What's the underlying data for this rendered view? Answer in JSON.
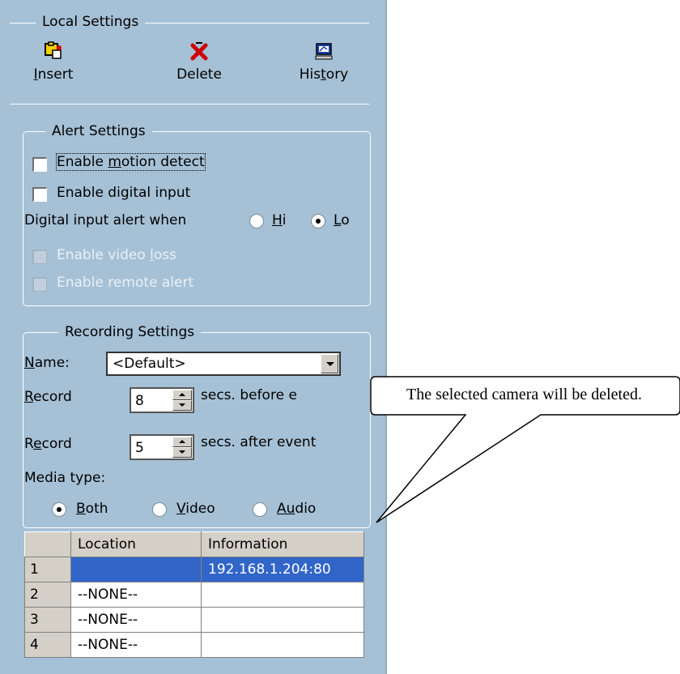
{
  "local_settings": {
    "title": "Local Settings",
    "tools": [
      {
        "icon": "insert-camera-icon",
        "label_pre": "",
        "label_u": "I",
        "label_post": "nsert"
      },
      {
        "icon": "delete-x-icon",
        "label_pre": "Delete",
        "label_u": "",
        "label_post": ""
      },
      {
        "icon": "history-monitor-icon",
        "label_pre": "His",
        "label_u": "t",
        "label_post": "ory"
      }
    ]
  },
  "alert_settings": {
    "title": "Alert Settings",
    "motion": {
      "pre": "Enable ",
      "u": "m",
      "post": "otion detect",
      "checked": false
    },
    "digital": {
      "pre": "Enable digital input",
      "checked": false
    },
    "alert_when": "Digital input alert when",
    "hi": {
      "u": "H",
      "post": "i",
      "selected": false
    },
    "lo": {
      "u": "L",
      "post": "o",
      "selected": true
    },
    "video_loss": {
      "pre": "Enable video ",
      "u": "l",
      "post": "oss",
      "enabled": false
    },
    "remote_alert": {
      "label": "Enable remote alert",
      "enabled": false
    }
  },
  "recording_settings": {
    "title": "Recording Settings",
    "name_label": {
      "u": "N",
      "post": "ame:"
    },
    "name_value": "<Default>",
    "before": {
      "u": "R",
      "post": "ecord",
      "value": "8",
      "suffix": "secs. before e"
    },
    "after": {
      "pre": "R",
      "u": "e",
      "post": "cord",
      "value": "5",
      "suffix": "secs. after event"
    },
    "media_type_label": "Media type:",
    "media": [
      {
        "u": "B",
        "post": "oth",
        "selected": true
      },
      {
        "u": "V",
        "post": "ideo",
        "selected": false
      },
      {
        "u": "Au",
        "post": "dio",
        "selected": false
      }
    ]
  },
  "table": {
    "headers": [
      "",
      "Location",
      "Information"
    ],
    "rows": [
      {
        "num": "1",
        "location": "",
        "information": "192.168.1.204:80"
      },
      {
        "num": "2",
        "location": "--NONE--",
        "information": ""
      },
      {
        "num": "3",
        "location": "--NONE--",
        "information": ""
      },
      {
        "num": "4",
        "location": "--NONE--",
        "information": ""
      }
    ]
  },
  "tooltip": {
    "text": "The selected camera will be deleted."
  },
  "colors": {
    "panel": "#a6c1d6",
    "selection": "#3165c8",
    "delete_icon": "#cc0000"
  }
}
